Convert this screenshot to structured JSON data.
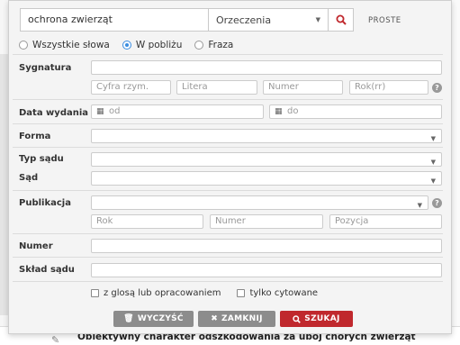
{
  "search": {
    "query_value": "ochrona zwierząt",
    "type_selected": "Orzeczenia",
    "mode_link": "PROSTE"
  },
  "match_modes": [
    {
      "label": "Wszystkie słowa",
      "selected": false
    },
    {
      "label": "W pobliżu",
      "selected": true
    },
    {
      "label": "Fraza",
      "selected": false
    }
  ],
  "fields": {
    "sygnatura_label": "Sygnatura",
    "sygnatura_parts": [
      "Cyfra rzym.",
      "Litera",
      "Numer",
      "Rok(rr)"
    ],
    "data_label": "Data wydania",
    "date_from_placeholder": "od",
    "date_to_placeholder": "do",
    "forma_label": "Forma",
    "typ_sadu_label": "Typ sądu",
    "sad_label": "Sąd",
    "publikacja_label": "Publikacja",
    "publikacja_parts": [
      "Rok",
      "Numer",
      "Pozycja"
    ],
    "numer_label": "Numer",
    "sklad_label": "Skład sądu"
  },
  "checkboxes": [
    {
      "label": "z glosą lub opracowaniem",
      "checked": false
    },
    {
      "label": "tylko cytowane",
      "checked": false
    }
  ],
  "buttons": {
    "clear": "WYCZYŚĆ",
    "close": "ZAMKNIJ",
    "search": "SZUKAJ"
  },
  "background": {
    "bottom_title": "Obiektywny charakter odszkodowania za ubój chorych zwierząt"
  },
  "colors": {
    "accent_red": "#c0282d",
    "radio_blue": "#3a8de0",
    "button_gray": "#8c8c8c"
  }
}
